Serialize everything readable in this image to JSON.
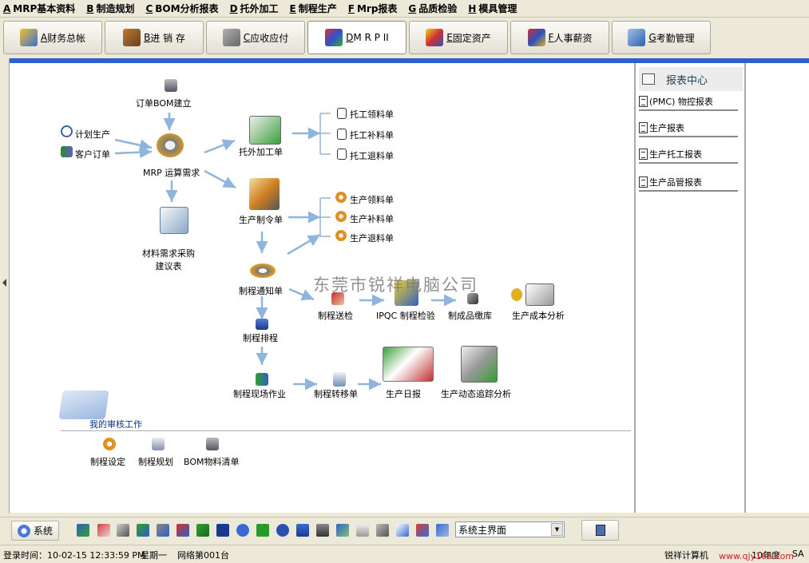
{
  "menu": [
    {
      "key": "A",
      "label": "MRP基本资料"
    },
    {
      "key": "B",
      "label": "制造规划"
    },
    {
      "key": "C",
      "label": "BOM分析报表"
    },
    {
      "key": "D",
      "label": "托外加工"
    },
    {
      "key": "E",
      "label": "制程生产"
    },
    {
      "key": "F",
      "label": "Mrp报表"
    },
    {
      "key": "G",
      "label": "品质检验"
    },
    {
      "key": "H",
      "label": "模具管理"
    }
  ],
  "tabs": [
    {
      "key": "A",
      "label": "财务总帐",
      "icon": "finance-icon"
    },
    {
      "key": "B",
      "label": "进 销 存",
      "icon": "truck-icon"
    },
    {
      "key": "C",
      "label": "应收应付",
      "icon": "safe-icon"
    },
    {
      "key": "D",
      "label": "M R P II",
      "icon": "cubes-icon",
      "active": true
    },
    {
      "key": "E",
      "label": "固定资产",
      "icon": "blocks-icon"
    },
    {
      "key": "F",
      "label": "人事薪资",
      "icon": "people-icon"
    },
    {
      "key": "G",
      "label": "考勤管理",
      "icon": "id-card-icon"
    }
  ],
  "flow": {
    "order_bom": "订单BOM建立",
    "plan_production": "计划生产",
    "customer_order": "客户订单",
    "mrp_calc": "MRP 运算需求",
    "material_purchase_1": "材料需求采购",
    "material_purchase_2": "建议表",
    "outsource": "托外加工单",
    "out_pick": "托工领料单",
    "out_supply": "托工补料单",
    "out_return": "托工退料单",
    "prod_order": "生产制令单",
    "prod_pick": "生产领料单",
    "prod_supply": "生产补料单",
    "prod_return": "生产退料单",
    "process_notice": "制程通知单",
    "process_send": "制程送检",
    "ipqc": "IPQC 制程检验",
    "finished_store": "制成品缴库",
    "cost_analysis": "生产成本分析",
    "process_schedule": "制程排程",
    "field_work": "制程现场作业",
    "process_transfer": "制程转移单",
    "daily_report": "生产日报",
    "dynamic_analysis": "生产动态追踪分析"
  },
  "watermark": "东莞市锐祥电脑公司",
  "audit": {
    "title": "我的审核工作",
    "items": [
      "制程设定",
      "制程规划",
      "BOM物料清单"
    ]
  },
  "report_center": {
    "title": "报表中心",
    "items": [
      "(PMC) 物控报表",
      "生产报表",
      "生产托工报表",
      "生产品管报表"
    ]
  },
  "bottom": {
    "system_button": "系统",
    "combo_value": "系统主界面",
    "combo_arrow": "▼"
  },
  "status": {
    "login_time": "登录时间：10-02-15 12:33:59 PM",
    "weekday": "星期一",
    "station": "网络第001台",
    "computer": "锐祥计算机",
    "year": "10年度",
    "user": "SA",
    "site": "www.qjy168.com"
  },
  "colors": {
    "accent_blue": "#2d5fd3",
    "arrow_blue": "#8fb4dd",
    "watermark_red": "#cc2222"
  }
}
